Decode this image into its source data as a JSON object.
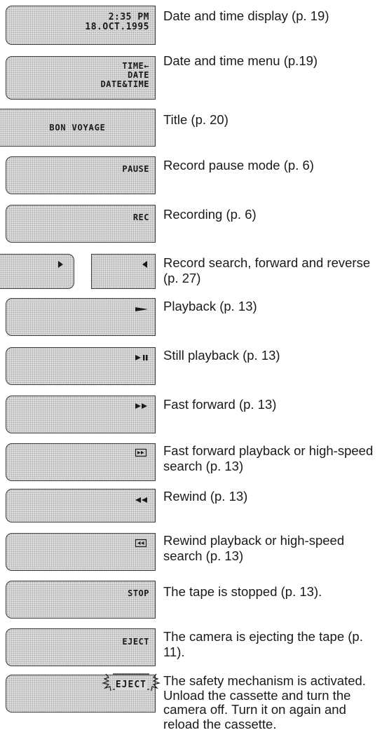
{
  "items": [
    {
      "id": "datetime-display",
      "indicator_line1": "2:35 PM",
      "indicator_line2": "18.OCT.1995",
      "description": "Date and time display (p. 19)"
    },
    {
      "id": "datetime-menu",
      "indicator_line1": "TIME←",
      "indicator_line2": "DATE",
      "indicator_line3": "DATE&TIME",
      "description": "Date and time menu (p.19)"
    },
    {
      "id": "title",
      "indicator_line1": "BON VOYAGE",
      "description": "Title (p. 20)"
    },
    {
      "id": "record-pause",
      "indicator_line1": "PAUSE",
      "description": "Record pause mode (p. 6)"
    },
    {
      "id": "recording",
      "indicator_line1": "REC",
      "description": "Recording (p. 6)"
    },
    {
      "id": "record-search",
      "icon": "play-right-icon + play-left-icon",
      "description": "Record search, forward and reverse (p. 27)"
    },
    {
      "id": "playback",
      "icon": "play-icon",
      "description": "Playback (p. 13)"
    },
    {
      "id": "still-playback",
      "icon": "play-pause-icon",
      "description": "Still playback (p. 13)"
    },
    {
      "id": "fast-forward",
      "icon": "fast-forward-icon",
      "description": "Fast forward (p. 13)"
    },
    {
      "id": "ff-playback",
      "icon": "boxed-fast-forward-icon",
      "description": "Fast forward playback or high-speed search (p. 13)"
    },
    {
      "id": "rewind",
      "icon": "rewind-icon",
      "description": "Rewind (p. 13)"
    },
    {
      "id": "rew-playback",
      "icon": "boxed-rewind-icon",
      "description": "Rewind playback or high-speed search (p. 13)"
    },
    {
      "id": "stop",
      "indicator_line1": "STOP",
      "description": "The tape is stopped (p. 13)."
    },
    {
      "id": "eject",
      "indicator_line1": "EJECT",
      "description": "The camera is ejecting the tape (p. 11)."
    },
    {
      "id": "eject-warning",
      "indicator_line1": "EJECT",
      "description": "The safety mechanism is activated. Unload the cassette and turn the camera off. Turn it on again and reload the cassette."
    }
  ]
}
